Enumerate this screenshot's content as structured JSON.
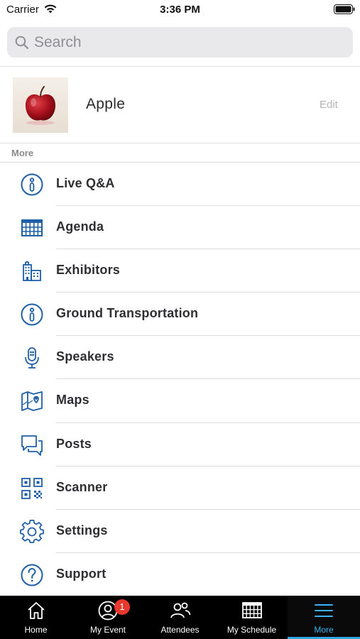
{
  "status_bar": {
    "carrier": "Carrier",
    "time": "3:36 PM"
  },
  "search": {
    "placeholder": "Search",
    "value": ""
  },
  "profile": {
    "name": "Apple",
    "edit_label": "Edit"
  },
  "section": {
    "title": "More"
  },
  "menu": {
    "items": [
      {
        "label": "Live Q&A",
        "icon": "info-icon"
      },
      {
        "label": "Agenda",
        "icon": "calendar-grid-icon"
      },
      {
        "label": "Exhibitors",
        "icon": "buildings-icon"
      },
      {
        "label": "Ground Transportation",
        "icon": "info-icon"
      },
      {
        "label": "Speakers",
        "icon": "microphone-icon"
      },
      {
        "label": "Maps",
        "icon": "map-icon"
      },
      {
        "label": "Posts",
        "icon": "chat-bubbles-icon"
      },
      {
        "label": "Scanner",
        "icon": "qr-code-icon"
      },
      {
        "label": "Settings",
        "icon": "gear-icon"
      },
      {
        "label": "Support",
        "icon": "question-icon"
      }
    ]
  },
  "tabs": [
    {
      "label": "Home",
      "icon": "home-icon"
    },
    {
      "label": "My Event",
      "icon": "person-circle-icon",
      "badge": "1"
    },
    {
      "label": "Attendees",
      "icon": "people-icon"
    },
    {
      "label": "My Schedule",
      "icon": "calendar-grid-icon"
    },
    {
      "label": "More",
      "icon": "hamburger-icon",
      "active": true
    }
  ],
  "colors": {
    "accent": "#1f5fa8",
    "tab_active": "#3ab3ee",
    "badge": "#e8392f"
  }
}
